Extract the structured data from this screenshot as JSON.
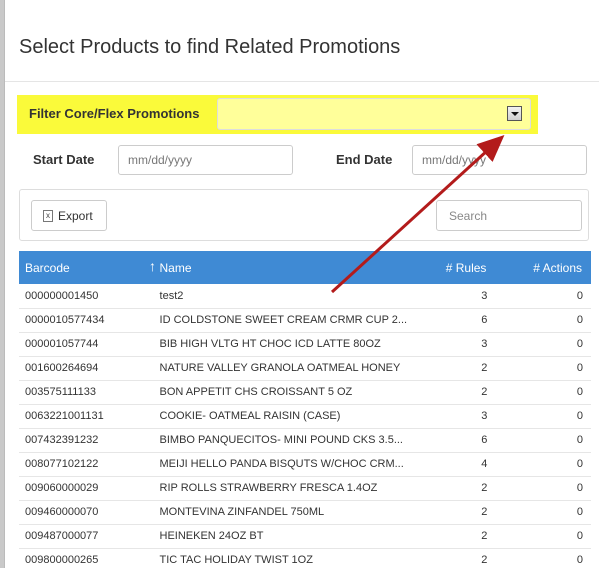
{
  "dialog": {
    "title": "Select Products to find Related Promotions"
  },
  "filter": {
    "label": "Filter Core/Flex Promotions",
    "value": ""
  },
  "dates": {
    "start_label": "Start Date",
    "start_placeholder": "mm/dd/yyyy",
    "end_label": "End Date",
    "end_placeholder": "mm/dd/yyyy"
  },
  "toolbar": {
    "export_label": "Export",
    "search_placeholder": "Search"
  },
  "table": {
    "columns": [
      "Barcode",
      "Name",
      "# Rules",
      "# Actions"
    ],
    "rows": [
      [
        "000000001450",
        "test2",
        "3",
        "0"
      ],
      [
        "0000010577434",
        "ID COLDSTONE SWEET CREAM CRMR CUP 2...",
        "6",
        "0"
      ],
      [
        "000001057744",
        "BIB HIGH VLTG HT CHOC ICD LATTE 80OZ",
        "3",
        "0"
      ],
      [
        "001600264694",
        "NATURE VALLEY GRANOLA OATMEAL HONEY",
        "2",
        "0"
      ],
      [
        "003575111133",
        "BON APPETIT CHS CROISSANT 5 OZ",
        "2",
        "0"
      ],
      [
        "0063221001131",
        "COOKIE- OATMEAL RAISIN (CASE)",
        "3",
        "0"
      ],
      [
        "007432391232",
        "BIMBO PANQUECITOS- MINI POUND CKS 3.5...",
        "6",
        "0"
      ],
      [
        "008077102122",
        "MEIJI HELLO PANDA BISQUTS W/CHOC CRM...",
        "4",
        "0"
      ],
      [
        "009060000029",
        "RIP ROLLS STRAWBERRY FRESCA 1.4OZ",
        "2",
        "0"
      ],
      [
        "009460000070",
        "MONTEVINA ZINFANDEL 750ML",
        "2",
        "0"
      ],
      [
        "009487000077",
        "HEINEKEN 24OZ BT",
        "2",
        "0"
      ],
      [
        "009800000265",
        "TIC TAC HOLIDAY TWIST 1OZ",
        "2",
        "0"
      ]
    ]
  },
  "colors": {
    "highlight": "#fafa3a",
    "header_blue": "#3f8ad4",
    "arrow": "#b31b1b"
  }
}
